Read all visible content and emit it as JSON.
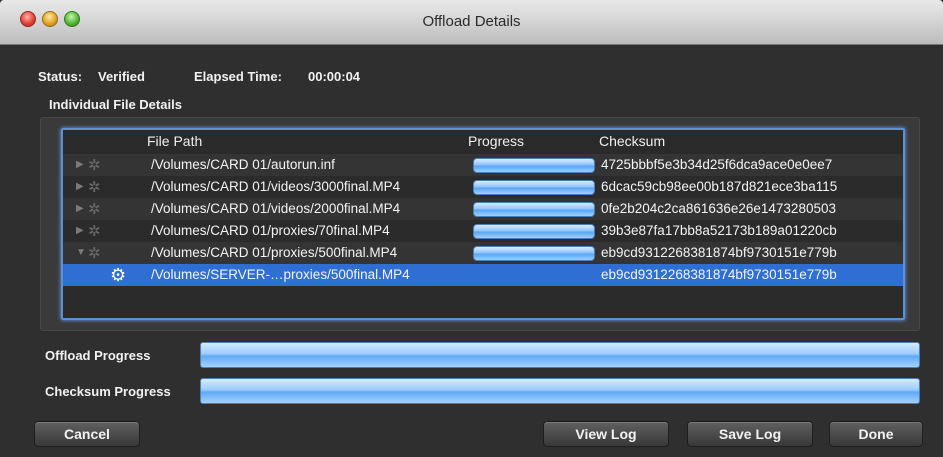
{
  "window": {
    "title": "Offload Details"
  },
  "status": {
    "label": "Status:",
    "value": "Verified",
    "elapsed_label": "Elapsed Time:",
    "elapsed_value": "00:00:04"
  },
  "section": {
    "title": "Individual File Details"
  },
  "table": {
    "columns": [
      "File Path",
      "Progress",
      "Checksum"
    ],
    "rows": [
      {
        "path": "/Volumes/CARD 01/autorun.inf",
        "progress": 1.0,
        "checksum": "4725bbbf5e3b34d25f6dca9ace0e0ee7",
        "icon": "gear-icon"
      },
      {
        "path": "/Volumes/CARD 01/videos/3000final.MP4",
        "progress": 1.0,
        "checksum": "6dcac59cb98ee00b187d821ece3ba115",
        "icon": "gear-icon"
      },
      {
        "path": "/Volumes/CARD 01/videos/2000final.MP4",
        "progress": 1.0,
        "checksum": "0fe2b204c2ca861636e26e1473280503",
        "icon": "gear-icon"
      },
      {
        "path": "/Volumes/CARD 01/proxies/70final.MP4",
        "progress": 1.0,
        "checksum": "39b3e87fa17bb8a52173b189a01220cb",
        "icon": "gear-icon"
      },
      {
        "path": "/Volumes/CARD 01/proxies/500final.MP4",
        "progress": 1.0,
        "checksum": "eb9cd9312268381874bf9730151e779b",
        "icon": "gear-icon",
        "expanded": true
      },
      {
        "path": "/Volumes/SERVER-…proxies/500final.MP4",
        "checksum": "eb9cd9312268381874bf9730151e779b",
        "icon": "gear-icon",
        "selected": true
      }
    ]
  },
  "offload_progress": {
    "label": "Offload Progress",
    "value": 1.0
  },
  "checksum_progress": {
    "label": "Checksum Progress",
    "value": 1.0
  },
  "buttons": {
    "cancel": "Cancel",
    "view_log": "View Log",
    "save_log": "Save Log",
    "done": "Done"
  }
}
